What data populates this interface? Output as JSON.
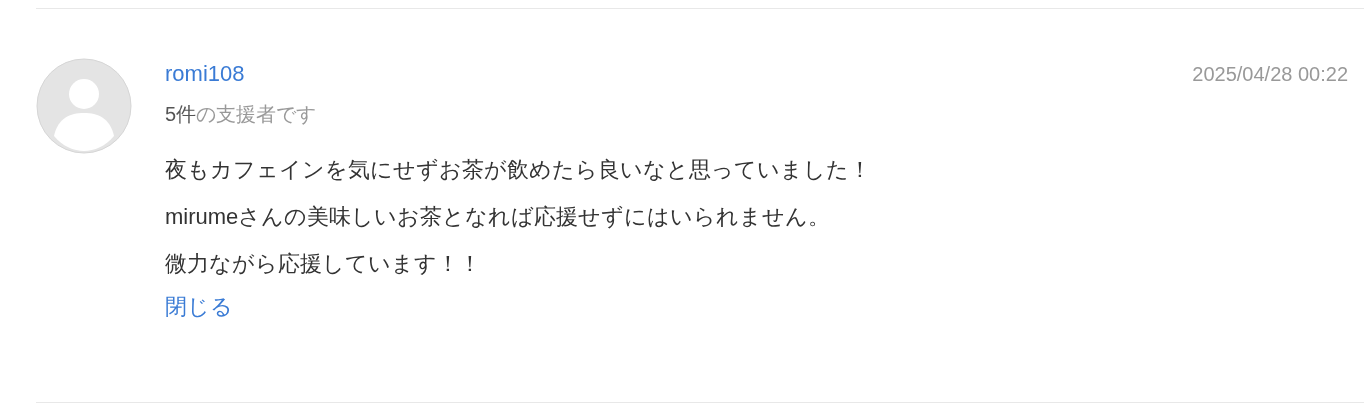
{
  "comment": {
    "author": "romi108",
    "support_count": "5件",
    "support_label": "の支援者です",
    "date": "2025/04/28 00:22",
    "lines": [
      "夜もカフェインを気にせずお茶が飲めたら良いなと思っていました！",
      "mirumeさんの美味しいお茶となれば応援せずにはいられません。",
      "微力ながら応援しています！！"
    ],
    "close_link": "閉じる"
  }
}
